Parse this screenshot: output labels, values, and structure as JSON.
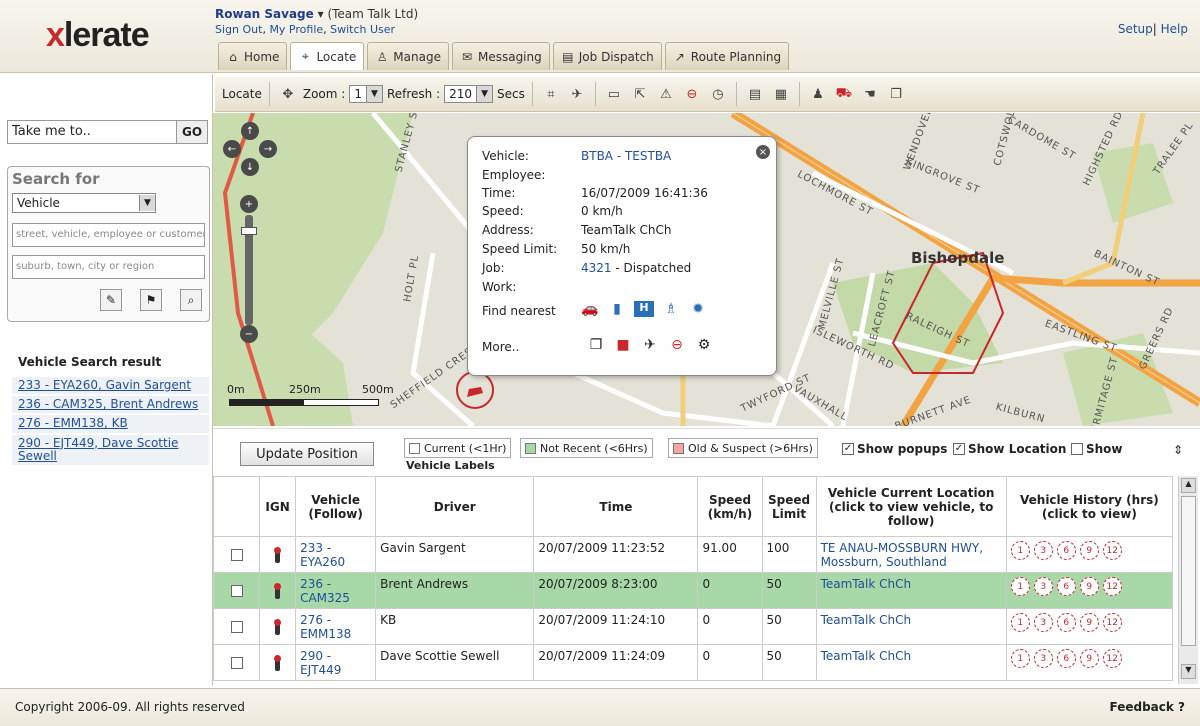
{
  "header": {
    "logo": {
      "prefix": "x",
      "rest": "lerate"
    },
    "user_name": "Rowan Savage",
    "user_org": "(Team Talk Ltd)",
    "links": [
      "Sign Out",
      "My Profile",
      "Switch User"
    ],
    "setup": "Setup",
    "help": "Help",
    "tabs": [
      {
        "label": "Home",
        "icon": "home-icon",
        "glyph": "⌂"
      },
      {
        "label": "Locate",
        "icon": "locate-icon",
        "glyph": "⌖",
        "active": true
      },
      {
        "label": "Manage",
        "icon": "manage-icon",
        "glyph": "♙"
      },
      {
        "label": "Messaging",
        "icon": "messaging-icon",
        "glyph": "✉"
      },
      {
        "label": "Job Dispatch",
        "icon": "job-dispatch-icon",
        "glyph": "▤"
      },
      {
        "label": "Route Planning",
        "icon": "route-planning-icon",
        "glyph": "↗"
      }
    ]
  },
  "toolbar": {
    "locate_label": "Locate",
    "zoom_label": "Zoom :",
    "zoom_value": "1",
    "refresh_label": "Refresh :",
    "refresh_value": "210",
    "secs_label": "Secs"
  },
  "sidebar": {
    "take_me_placeholder": "Take me to..",
    "go_label": "GO",
    "search_title": "Search for",
    "search_type": "Vehicle",
    "field1_placeholder": "street, vehicle, employee or customer",
    "field2_placeholder": "suburb, town, city or region",
    "result_title": "Vehicle Search result",
    "results": [
      "233 - EYA260, Gavin Sargent",
      "236 - CAM325, Brent Andrews",
      "276 - EMM138, KB",
      "290 - EJT449, Dave Scottie Sewell"
    ]
  },
  "map": {
    "suburb": "Bishopdale",
    "streets": [
      "STANLEY ST",
      "WENDOVER",
      "COTSWOLD",
      "CARDOME ST",
      "HIGHSTED RD",
      "TRALEE PL",
      "KINGROVE ST",
      "LOCHMORE ST",
      "BAINTON ST",
      "HOLT PL",
      "MELVILLE ST",
      "LEACROFT ST",
      "RALEIGH ST",
      "EASTLING ST",
      "ISLEWORTH RD",
      "SHEFFIELD CRES",
      "TWYFORD ST",
      "VAUXHALL",
      "GREERS RD",
      "KILBURN",
      "HERMITAGE ST",
      "BURNETT AVE"
    ],
    "scale": {
      "zero": "0m",
      "mid": "250m",
      "max": "500m"
    }
  },
  "popup": {
    "rows": [
      {
        "label": "Vehicle:",
        "value": "BTBA - TESTBA",
        "link": true
      },
      {
        "label": "Employee:",
        "value": ""
      },
      {
        "label": "Time:",
        "value": "16/07/2009 16:41:36"
      },
      {
        "label": "Speed:",
        "value": "0 km/h"
      },
      {
        "label": "Address:",
        "value": "TeamTalk ChCh"
      },
      {
        "label": "Speed Limit:",
        "value": "50 km/h"
      },
      {
        "label": "Job:",
        "value": "4321",
        "link": true,
        "suffix": " - Dispatched"
      },
      {
        "label": "Work:",
        "value": ""
      }
    ],
    "find_nearest_label": "Find nearest",
    "more_label": "More.."
  },
  "controls": {
    "update_label": "Update Position",
    "legend": [
      {
        "label": "Current (<1Hr)",
        "color": "#ffffff"
      },
      {
        "label": "Not Recent (<6Hrs)",
        "color": "#a8d8a8"
      },
      {
        "label": "Old & Suspect (>6Hrs)",
        "color": "#f4a6a6"
      }
    ],
    "vehicle_labels": "Vehicle Labels",
    "show_popups": "Show popups",
    "show_location": "Show Location",
    "show": "Show"
  },
  "table": {
    "headers": {
      "ign": "IGN",
      "vehicle": "Vehicle (Follow)",
      "driver": "Driver",
      "time": "Time",
      "speed": "Speed (km/h)",
      "limit": "Speed Limit",
      "location": "Vehicle Current Location (click to view vehicle, to follow)",
      "history": "Vehicle History (hrs) (click to view)"
    },
    "history_hours": [
      "1",
      "3",
      "6",
      "9",
      "12"
    ],
    "rows": [
      {
        "vehicle": "233 - EYA260",
        "driver": "Gavin Sargent",
        "time": "20/07/2009 11:23:52",
        "speed": "91.00",
        "limit": "100",
        "location": "TE ANAU-MOSSBURN HWY, Mossburn, Southland"
      },
      {
        "vehicle": "236 - CAM325",
        "driver": "Brent Andrews",
        "time": "20/07/2009 8:23:00",
        "speed": "0",
        "limit": "50",
        "location": "TeamTalk ChCh",
        "highlight": true
      },
      {
        "vehicle": "276 - EMM138",
        "driver": "KB",
        "time": "20/07/2009 11:24:10",
        "speed": "0",
        "limit": "50",
        "location": "TeamTalk ChCh"
      },
      {
        "vehicle": "290 - EJT449",
        "driver": "Dave Scottie Sewell",
        "time": "20/07/2009 11:24:09",
        "speed": "0",
        "limit": "50",
        "location": "TeamTalk ChCh"
      }
    ]
  },
  "footer": {
    "copyright": "Copyright 2006-09. All rights reserved",
    "feedback": "Feedback"
  },
  "colors": {
    "brand_red": "#c8282b",
    "link_blue": "#1f4f9a",
    "row_green": "#a8d8a8",
    "road_orange": "#f2a442"
  }
}
